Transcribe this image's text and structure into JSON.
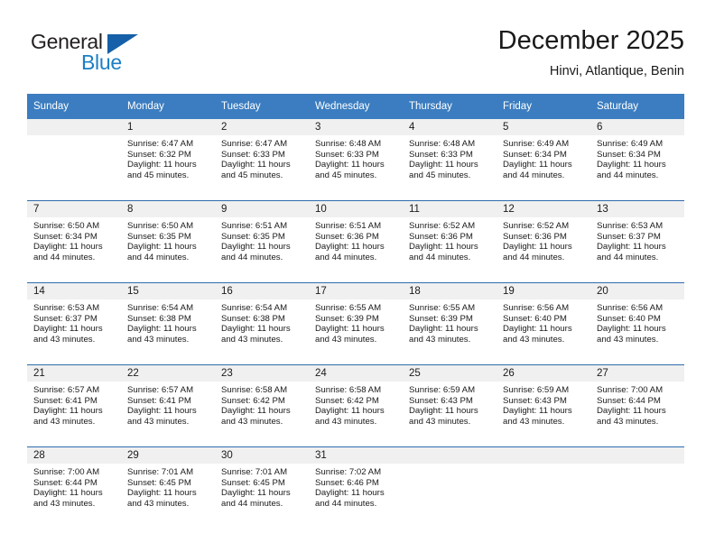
{
  "brand": {
    "name_part1": "General",
    "name_part2": "Blue",
    "accent_dark": "#1560a8",
    "accent_blue": "#1b7fc4"
  },
  "header": {
    "title": "December 2025",
    "subtitle": "Hinvi, Atlantique, Benin"
  },
  "calendar": {
    "header_bg": "#3b7dc0",
    "daynum_bg": "#f0f0f0",
    "row_border": "#2f6cad",
    "weekday_headers": [
      "Sunday",
      "Monday",
      "Tuesday",
      "Wednesday",
      "Thursday",
      "Friday",
      "Saturday"
    ],
    "weeks": [
      [
        {
          "day": "",
          "lines": []
        },
        {
          "day": "1",
          "lines": [
            "Sunrise: 6:47 AM",
            "Sunset: 6:32 PM",
            "Daylight: 11 hours",
            "and 45 minutes."
          ]
        },
        {
          "day": "2",
          "lines": [
            "Sunrise: 6:47 AM",
            "Sunset: 6:33 PM",
            "Daylight: 11 hours",
            "and 45 minutes."
          ]
        },
        {
          "day": "3",
          "lines": [
            "Sunrise: 6:48 AM",
            "Sunset: 6:33 PM",
            "Daylight: 11 hours",
            "and 45 minutes."
          ]
        },
        {
          "day": "4",
          "lines": [
            "Sunrise: 6:48 AM",
            "Sunset: 6:33 PM",
            "Daylight: 11 hours",
            "and 45 minutes."
          ]
        },
        {
          "day": "5",
          "lines": [
            "Sunrise: 6:49 AM",
            "Sunset: 6:34 PM",
            "Daylight: 11 hours",
            "and 44 minutes."
          ]
        },
        {
          "day": "6",
          "lines": [
            "Sunrise: 6:49 AM",
            "Sunset: 6:34 PM",
            "Daylight: 11 hours",
            "and 44 minutes."
          ]
        }
      ],
      [
        {
          "day": "7",
          "lines": [
            "Sunrise: 6:50 AM",
            "Sunset: 6:34 PM",
            "Daylight: 11 hours",
            "and 44 minutes."
          ]
        },
        {
          "day": "8",
          "lines": [
            "Sunrise: 6:50 AM",
            "Sunset: 6:35 PM",
            "Daylight: 11 hours",
            "and 44 minutes."
          ]
        },
        {
          "day": "9",
          "lines": [
            "Sunrise: 6:51 AM",
            "Sunset: 6:35 PM",
            "Daylight: 11 hours",
            "and 44 minutes."
          ]
        },
        {
          "day": "10",
          "lines": [
            "Sunrise: 6:51 AM",
            "Sunset: 6:36 PM",
            "Daylight: 11 hours",
            "and 44 minutes."
          ]
        },
        {
          "day": "11",
          "lines": [
            "Sunrise: 6:52 AM",
            "Sunset: 6:36 PM",
            "Daylight: 11 hours",
            "and 44 minutes."
          ]
        },
        {
          "day": "12",
          "lines": [
            "Sunrise: 6:52 AM",
            "Sunset: 6:36 PM",
            "Daylight: 11 hours",
            "and 44 minutes."
          ]
        },
        {
          "day": "13",
          "lines": [
            "Sunrise: 6:53 AM",
            "Sunset: 6:37 PM",
            "Daylight: 11 hours",
            "and 44 minutes."
          ]
        }
      ],
      [
        {
          "day": "14",
          "lines": [
            "Sunrise: 6:53 AM",
            "Sunset: 6:37 PM",
            "Daylight: 11 hours",
            "and 43 minutes."
          ]
        },
        {
          "day": "15",
          "lines": [
            "Sunrise: 6:54 AM",
            "Sunset: 6:38 PM",
            "Daylight: 11 hours",
            "and 43 minutes."
          ]
        },
        {
          "day": "16",
          "lines": [
            "Sunrise: 6:54 AM",
            "Sunset: 6:38 PM",
            "Daylight: 11 hours",
            "and 43 minutes."
          ]
        },
        {
          "day": "17",
          "lines": [
            "Sunrise: 6:55 AM",
            "Sunset: 6:39 PM",
            "Daylight: 11 hours",
            "and 43 minutes."
          ]
        },
        {
          "day": "18",
          "lines": [
            "Sunrise: 6:55 AM",
            "Sunset: 6:39 PM",
            "Daylight: 11 hours",
            "and 43 minutes."
          ]
        },
        {
          "day": "19",
          "lines": [
            "Sunrise: 6:56 AM",
            "Sunset: 6:40 PM",
            "Daylight: 11 hours",
            "and 43 minutes."
          ]
        },
        {
          "day": "20",
          "lines": [
            "Sunrise: 6:56 AM",
            "Sunset: 6:40 PM",
            "Daylight: 11 hours",
            "and 43 minutes."
          ]
        }
      ],
      [
        {
          "day": "21",
          "lines": [
            "Sunrise: 6:57 AM",
            "Sunset: 6:41 PM",
            "Daylight: 11 hours",
            "and 43 minutes."
          ]
        },
        {
          "day": "22",
          "lines": [
            "Sunrise: 6:57 AM",
            "Sunset: 6:41 PM",
            "Daylight: 11 hours",
            "and 43 minutes."
          ]
        },
        {
          "day": "23",
          "lines": [
            "Sunrise: 6:58 AM",
            "Sunset: 6:42 PM",
            "Daylight: 11 hours",
            "and 43 minutes."
          ]
        },
        {
          "day": "24",
          "lines": [
            "Sunrise: 6:58 AM",
            "Sunset: 6:42 PM",
            "Daylight: 11 hours",
            "and 43 minutes."
          ]
        },
        {
          "day": "25",
          "lines": [
            "Sunrise: 6:59 AM",
            "Sunset: 6:43 PM",
            "Daylight: 11 hours",
            "and 43 minutes."
          ]
        },
        {
          "day": "26",
          "lines": [
            "Sunrise: 6:59 AM",
            "Sunset: 6:43 PM",
            "Daylight: 11 hours",
            "and 43 minutes."
          ]
        },
        {
          "day": "27",
          "lines": [
            "Sunrise: 7:00 AM",
            "Sunset: 6:44 PM",
            "Daylight: 11 hours",
            "and 43 minutes."
          ]
        }
      ],
      [
        {
          "day": "28",
          "lines": [
            "Sunrise: 7:00 AM",
            "Sunset: 6:44 PM",
            "Daylight: 11 hours",
            "and 43 minutes."
          ]
        },
        {
          "day": "29",
          "lines": [
            "Sunrise: 7:01 AM",
            "Sunset: 6:45 PM",
            "Daylight: 11 hours",
            "and 43 minutes."
          ]
        },
        {
          "day": "30",
          "lines": [
            "Sunrise: 7:01 AM",
            "Sunset: 6:45 PM",
            "Daylight: 11 hours",
            "and 44 minutes."
          ]
        },
        {
          "day": "31",
          "lines": [
            "Sunrise: 7:02 AM",
            "Sunset: 6:46 PM",
            "Daylight: 11 hours",
            "and 44 minutes."
          ]
        },
        {
          "day": "",
          "lines": []
        },
        {
          "day": "",
          "lines": []
        },
        {
          "day": "",
          "lines": []
        }
      ]
    ]
  }
}
